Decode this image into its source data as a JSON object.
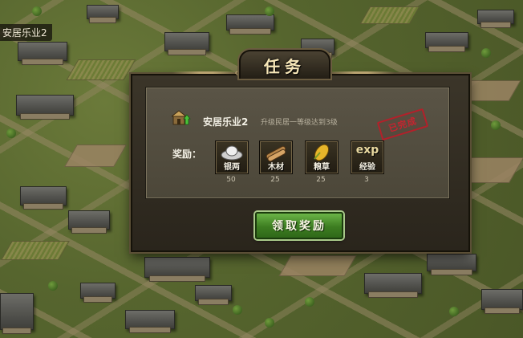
{
  "map": {
    "city_label": "安居乐业2"
  },
  "dialog": {
    "title": "任务",
    "quest": {
      "icon": "house-upgrade-icon",
      "name": "安居乐业2",
      "description": "升级民居一等级达到3级",
      "stamp": "已完成",
      "stamp_color": "#c8232f"
    },
    "rewards_label": "奖励：",
    "rewards": [
      {
        "icon": "silver-ingot-icon",
        "label": "银两",
        "amount": "50"
      },
      {
        "icon": "wood-logs-icon",
        "label": "木材",
        "amount": "25"
      },
      {
        "icon": "grain-icon",
        "label": "粮草",
        "amount": "25"
      },
      {
        "icon": "exp-icon",
        "icon_text": "exp",
        "label": "经验",
        "amount": "3"
      }
    ],
    "claim_button": "领取奖励",
    "claim_button_color": "#3d7d21"
  }
}
